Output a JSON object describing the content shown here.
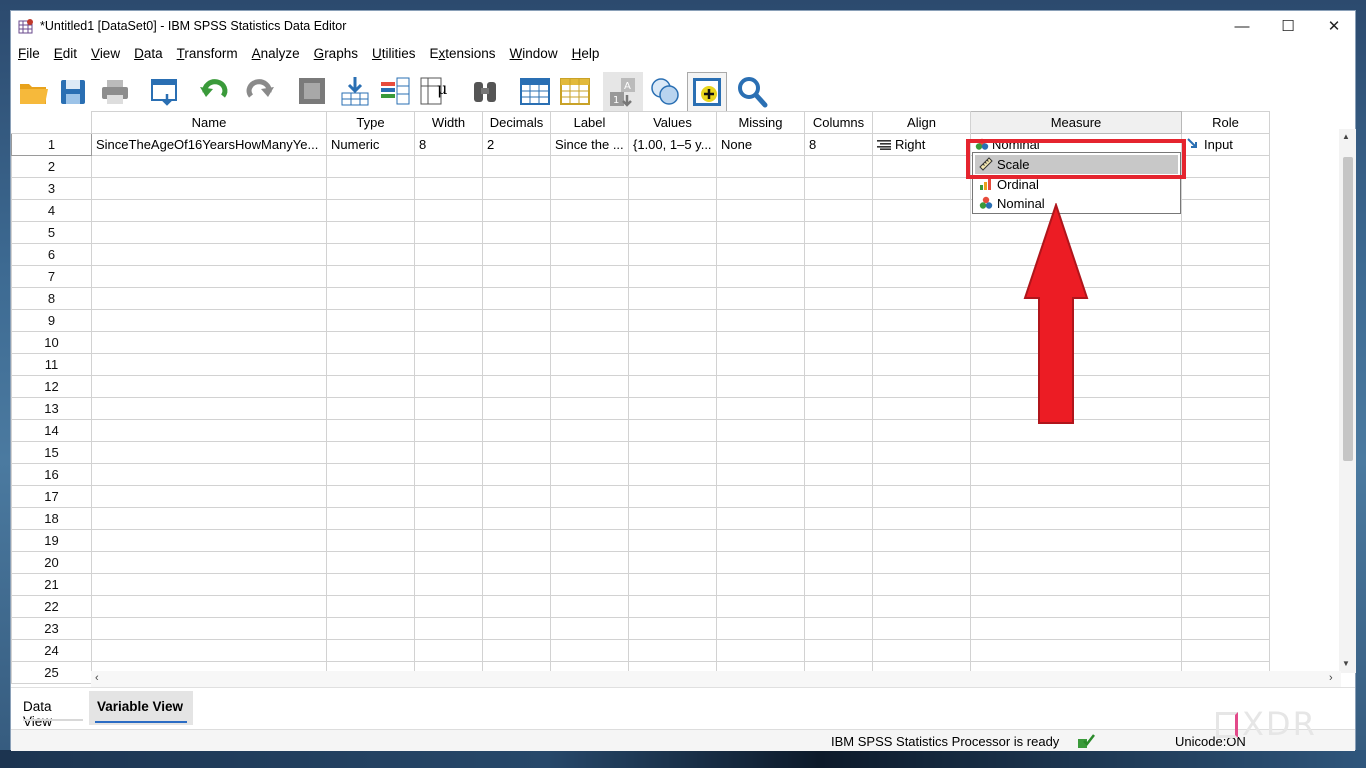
{
  "window": {
    "title": "*Untitled1 [DataSet0] - IBM SPSS Statistics Data Editor",
    "minimize": "—",
    "maximize": "☐",
    "close": "✕"
  },
  "menu": [
    {
      "label": "File",
      "ul": "F",
      "rest": "ile"
    },
    {
      "label": "Edit",
      "ul": "E",
      "rest": "dit"
    },
    {
      "label": "View",
      "ul": "V",
      "rest": "iew"
    },
    {
      "label": "Data",
      "ul": "D",
      "rest": "ata"
    },
    {
      "label": "Transform",
      "ul": "T",
      "rest": "ransform"
    },
    {
      "label": "Analyze",
      "ul": "A",
      "rest": "nalyze"
    },
    {
      "label": "Graphs",
      "ul": "G",
      "rest": "raphs"
    },
    {
      "label": "Utilities",
      "ul": "U",
      "rest": "tilities"
    },
    {
      "label": "Extensions",
      "ul": "X",
      "pre": "E",
      "rest": "tensions"
    },
    {
      "label": "Window",
      "ul": "W",
      "rest": "indow"
    },
    {
      "label": "Help",
      "ul": "H",
      "rest": "elp"
    }
  ],
  "toolbar_icons": [
    "open-folder-icon",
    "save-icon",
    "print-icon",
    "recall-dialog-icon",
    "undo-icon",
    "redo-icon",
    "goto-case-icon",
    "goto-variable-icon",
    "variables-icon",
    "descriptives-icon",
    "find-icon",
    "insert-cases-icon",
    "insert-variable-icon",
    "split-file-icon",
    "weight-cases-icon",
    "select-cases-icon",
    "value-labels-icon",
    "use-variable-sets-icon",
    "search-icon"
  ],
  "grid": {
    "headers": [
      "Name",
      "Type",
      "Width",
      "Decimals",
      "Label",
      "Values",
      "Missing",
      "Columns",
      "Align",
      "Measure",
      "Role"
    ],
    "row1": {
      "num": "1",
      "name": "SinceTheAgeOf16YearsHowManyYe...",
      "type": "Numeric",
      "width": "8",
      "decimals": "2",
      "label": "Since the ...",
      "values": "{1.00, 1–5 y...",
      "missing": "None",
      "columns": "8",
      "align": "Right",
      "measure": "Nominal",
      "role": "Input"
    },
    "row_numbers": [
      "2",
      "3",
      "4",
      "5",
      "6",
      "7",
      "8",
      "9",
      "10",
      "11",
      "12",
      "13",
      "14",
      "15",
      "16",
      "17",
      "18",
      "19",
      "20",
      "21",
      "22",
      "23",
      "24",
      "25"
    ]
  },
  "dropdown": {
    "options": [
      {
        "label": "Scale",
        "icon": "ruler-icon",
        "selected": true
      },
      {
        "label": "Ordinal",
        "icon": "bar-chart-icon"
      },
      {
        "label": "Nominal",
        "icon": "three-balls-icon"
      }
    ]
  },
  "tabs": {
    "data_view": "Data View",
    "variable_view": "Variable View"
  },
  "status": {
    "processor": "IBM SPSS Statistics Processor is ready",
    "unicode": "Unicode:ON"
  },
  "watermark": "XDR",
  "colors": {
    "highlight": "#e5242e",
    "arrow": "#ec1c24",
    "active_tab_underline": "#2b6cc4"
  }
}
